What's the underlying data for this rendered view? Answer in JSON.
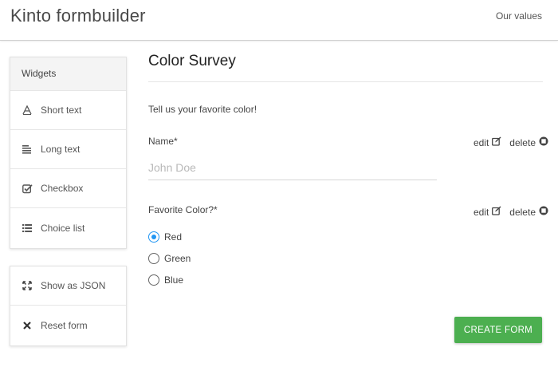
{
  "navbar": {
    "brand": "Kinto formbuilder",
    "link": "Our values"
  },
  "sidebar": {
    "widgets_header": "Widgets",
    "widgets": [
      {
        "label": "Short text",
        "icon": "text-format-icon"
      },
      {
        "label": "Long text",
        "icon": "text-lines-icon"
      },
      {
        "label": "Checkbox",
        "icon": "checkbox-icon"
      },
      {
        "label": "Choice list",
        "icon": "list-icon"
      }
    ],
    "actions": [
      {
        "label": "Show as JSON",
        "icon": "expand-icon"
      },
      {
        "label": "Reset form",
        "icon": "close-icon"
      }
    ]
  },
  "form": {
    "title": "Color Survey",
    "description": "Tell us your favorite color!",
    "fields": [
      {
        "label": "Name*",
        "type": "text",
        "placeholder": "John Doe",
        "value": "",
        "edit_label": "edit",
        "delete_label": "delete"
      },
      {
        "label": "Favorite Color?*",
        "type": "radio",
        "options": [
          "Red",
          "Green",
          "Blue"
        ],
        "selected": "Red",
        "edit_label": "edit",
        "delete_label": "delete"
      }
    ],
    "submit_label": "CREATE FORM"
  },
  "colors": {
    "accent": "#2196f3",
    "submit": "#4caf50"
  }
}
